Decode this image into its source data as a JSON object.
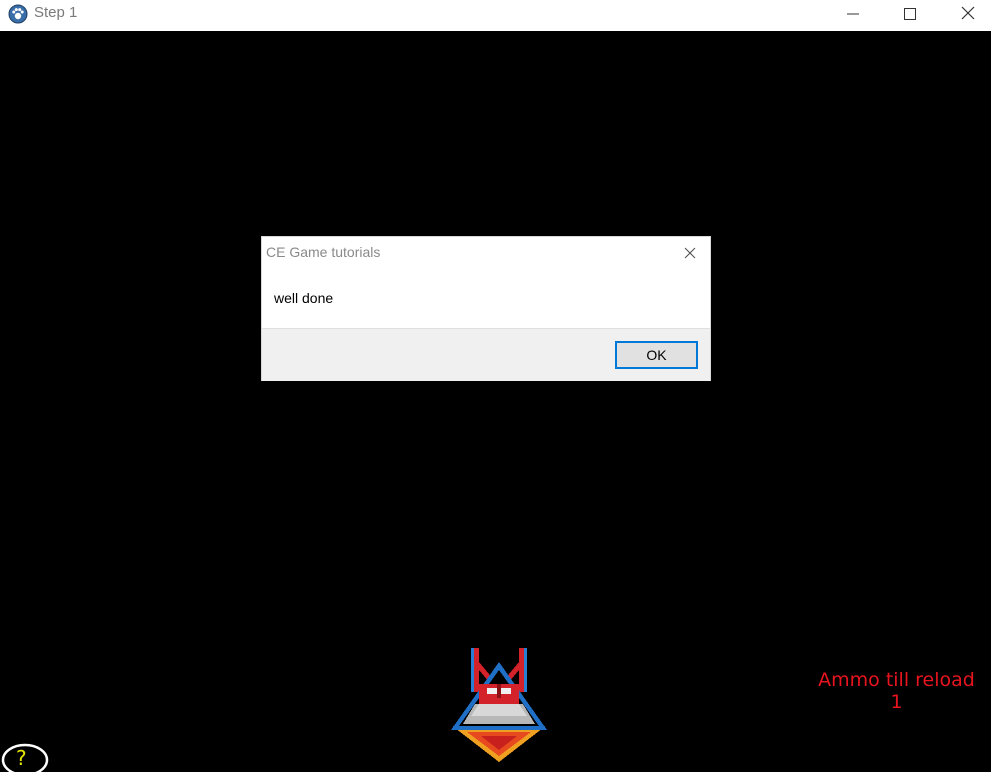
{
  "window": {
    "title": "Step 1",
    "icon": "cheat-engine-paw-icon",
    "controls": {
      "minimize": "minimize-icon",
      "maximize": "maximize-icon",
      "close": "close-icon"
    }
  },
  "dialog": {
    "title": "CE Game tutorials",
    "message": "well done",
    "ok_label": "OK",
    "close_icon": "close-icon",
    "accent_color": "#0078d7"
  },
  "hud": {
    "ammo_label": "Ammo till reload",
    "ammo_count": "1",
    "color": "#e8141e"
  },
  "help": {
    "glyph": "?",
    "icon": "help-icon",
    "color": "#e6e600"
  },
  "ship": {
    "icon": "player-spaceship-icon"
  },
  "colors": {
    "background": "#000000",
    "titlebar": "#ffffff"
  }
}
